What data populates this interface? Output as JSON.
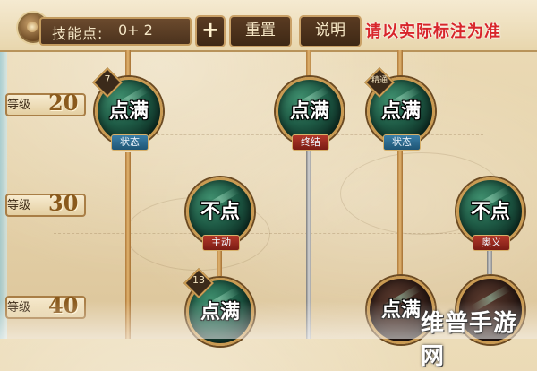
{
  "header": {
    "skill_points_label": "技能点:",
    "skill_points_value": "0+ 2",
    "plus_label": "+",
    "reset_label": "重置",
    "help_label": "说明",
    "notice": "请以实际标注为准"
  },
  "levels": [
    {
      "word": "等级",
      "number": "20"
    },
    {
      "word": "等级",
      "number": "30"
    },
    {
      "word": "等级",
      "number": "40"
    }
  ],
  "nodes": [
    {
      "status": "点满",
      "tag": "状态",
      "badge": "7"
    },
    {
      "status": "点满",
      "tag": "终结",
      "badge": ""
    },
    {
      "status": "点满",
      "tag": "状态",
      "badge": "精通"
    },
    {
      "status": "不点",
      "tag": "主动",
      "badge": ""
    },
    {
      "status": "不点",
      "tag": "奥义",
      "badge": ""
    },
    {
      "status": "点满",
      "tag": "",
      "badge": "13"
    },
    {
      "status": "点满",
      "tag": "",
      "badge": ""
    }
  ],
  "watermark": "维普手游网",
  "colors": {
    "notice": "#d8262b",
    "tag_blue": "#2a6a92",
    "tag_red": "#9a2a1e",
    "parchment": "#e6d3ab"
  }
}
